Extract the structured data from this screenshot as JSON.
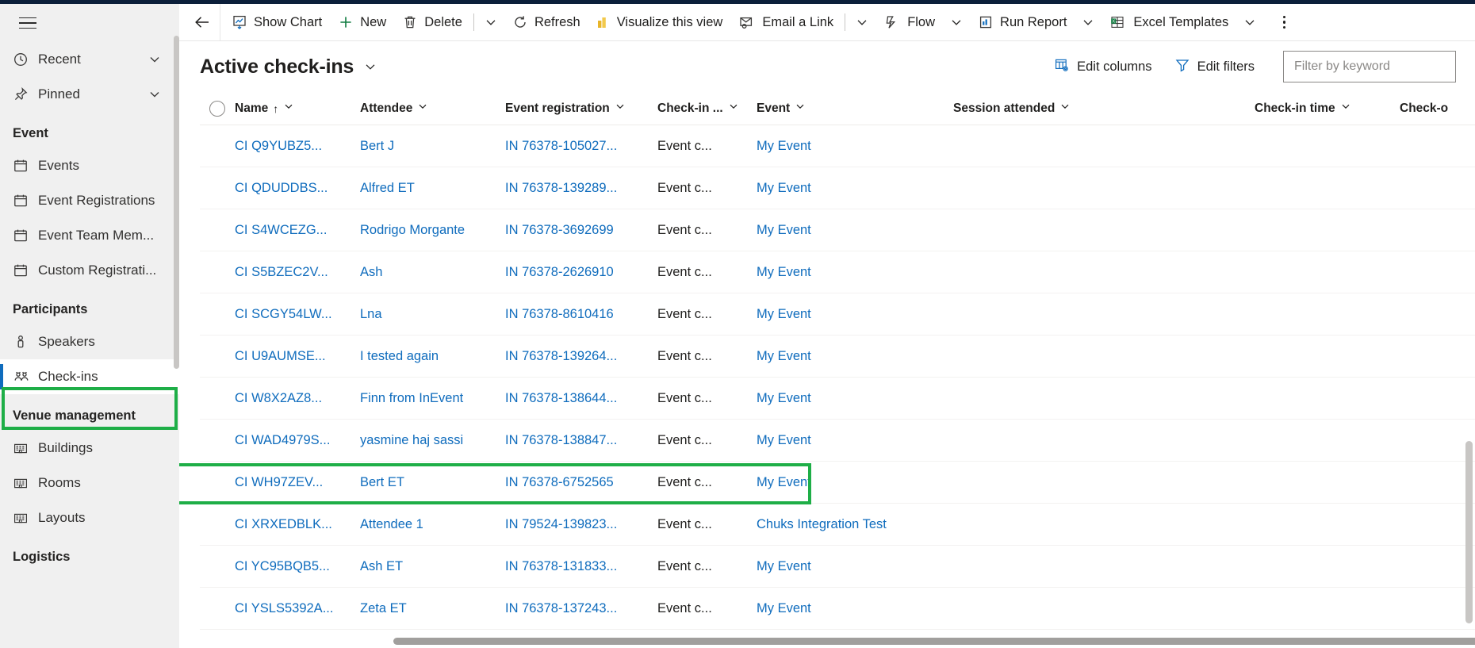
{
  "sidebar": {
    "menu_icon": "hamburger-icon",
    "top_items": [
      {
        "label": "Recent",
        "icon": "clock-icon",
        "chevron": "chevron-down-icon"
      },
      {
        "label": "Pinned",
        "icon": "pin-icon",
        "chevron": "chevron-down-icon"
      }
    ],
    "groups": [
      {
        "heading": "Event",
        "items": [
          {
            "label": "Events",
            "icon": "calendar-icon"
          },
          {
            "label": "Event Registrations",
            "icon": "calendar-icon"
          },
          {
            "label": "Event Team Mem...",
            "icon": "calendar-icon"
          },
          {
            "label": "Custom Registrati...",
            "icon": "calendar-icon"
          }
        ]
      },
      {
        "heading": "Participants",
        "items": [
          {
            "label": "Speakers",
            "icon": "speaker-person-icon"
          },
          {
            "label": "Check-ins",
            "icon": "check-in-people-icon",
            "selected": true
          }
        ]
      },
      {
        "heading": "Venue management",
        "items": [
          {
            "label": "Buildings",
            "icon": "building-icon"
          },
          {
            "label": "Rooms",
            "icon": "building-icon"
          },
          {
            "label": "Layouts",
            "icon": "building-icon"
          }
        ]
      },
      {
        "heading": "Logistics",
        "items": []
      }
    ]
  },
  "commandbar": {
    "back_icon": "back-arrow-icon",
    "buttons": [
      {
        "label": "Show Chart",
        "icon": "chart-icon"
      },
      {
        "label": "New",
        "icon": "plus-icon"
      },
      {
        "label": "Delete",
        "icon": "trash-icon",
        "chevron": "chevron-down-icon",
        "separator_before_chevron": true
      },
      {
        "label": "Refresh",
        "icon": "refresh-icon"
      },
      {
        "label": "Visualize this view",
        "icon": "powerbi-icon"
      },
      {
        "label": "Email a Link",
        "icon": "email-icon",
        "chevron": "chevron-down-icon",
        "separator_before_chevron": true
      },
      {
        "label": "Flow",
        "icon": "flow-icon",
        "chevron": "chevron-down-icon"
      },
      {
        "label": "Run Report",
        "icon": "report-icon",
        "chevron": "chevron-down-icon"
      },
      {
        "label": "Excel Templates",
        "icon": "excel-icon",
        "chevron": "chevron-down-icon"
      }
    ],
    "overflow_icon": "more-vertical-icon"
  },
  "view": {
    "title": "Active check-ins",
    "title_chevron": "chevron-down-icon",
    "edit_columns": {
      "label": "Edit columns",
      "icon": "edit-columns-icon"
    },
    "edit_filters": {
      "label": "Edit filters",
      "icon": "filter-icon"
    },
    "filter_input": {
      "placeholder": "Filter by keyword",
      "value": ""
    }
  },
  "grid": {
    "select_all_icon": "radio-circle-icon",
    "columns": [
      {
        "label": "Name",
        "sorted": "ascending",
        "sort_icon": "arrow-up-icon",
        "chevron": "chevron-down-icon"
      },
      {
        "label": "Attendee",
        "chevron": "chevron-down-icon"
      },
      {
        "label": "Event registration",
        "chevron": "chevron-down-icon"
      },
      {
        "label": "Check-in ...",
        "chevron": "chevron-down-icon"
      },
      {
        "label": "Event",
        "chevron": "chevron-down-icon"
      },
      {
        "label": "Session attended",
        "chevron": "chevron-down-icon"
      },
      {
        "label": "Check-in time",
        "chevron": "chevron-down-icon"
      },
      {
        "label": "Check-o",
        "chevron": ""
      }
    ],
    "rows": [
      {
        "name": "CI Q9YUBZ5...",
        "attendee": "Bert J",
        "registration": "IN 76378-105027...",
        "checkin_type": "Event c...",
        "event": "My Event",
        "session": "",
        "checkin_time": "",
        "checkout": ""
      },
      {
        "name": "CI QDUDDBS...",
        "attendee": "Alfred ET",
        "registration": "IN 76378-139289...",
        "checkin_type": "Event c...",
        "event": "My Event",
        "session": "",
        "checkin_time": "",
        "checkout": ""
      },
      {
        "name": "CI S4WCEZG...",
        "attendee": "Rodrigo Morgante",
        "registration": "IN 76378-3692699",
        "checkin_type": "Event c...",
        "event": "My Event",
        "session": "",
        "checkin_time": "",
        "checkout": ""
      },
      {
        "name": "CI S5BZEC2V...",
        "attendee": "Ash",
        "registration": "IN 76378-2626910",
        "checkin_type": "Event c...",
        "event": "My Event",
        "session": "",
        "checkin_time": "",
        "checkout": ""
      },
      {
        "name": "CI SCGY54LW...",
        "attendee": "Lna",
        "registration": "IN 76378-8610416",
        "checkin_type": "Event c...",
        "event": "My Event",
        "session": "",
        "checkin_time": "",
        "checkout": ""
      },
      {
        "name": "CI U9AUMSE...",
        "attendee": "I tested again",
        "registration": "IN 76378-139264...",
        "checkin_type": "Event c...",
        "event": "My Event",
        "session": "",
        "checkin_time": "",
        "checkout": ""
      },
      {
        "name": "CI W8X2AZ8...",
        "attendee": "Finn from InEvent",
        "registration": "IN 76378-138644...",
        "checkin_type": "Event c...",
        "event": "My Event",
        "session": "",
        "checkin_time": "",
        "checkout": ""
      },
      {
        "name": "CI WAD4979S...",
        "attendee": "yasmine haj sassi",
        "registration": "IN 76378-138847...",
        "checkin_type": "Event c...",
        "event": "My Event",
        "session": "",
        "checkin_time": "",
        "checkout": ""
      },
      {
        "name": "CI WH97ZEV...",
        "attendee": "Bert ET",
        "registration": "IN 76378-6752565",
        "checkin_type": "Event c...",
        "event": "My Event",
        "session": "",
        "checkin_time": "",
        "checkout": ""
      },
      {
        "name": "CI XRXEDBLK...",
        "attendee": "Attendee 1",
        "registration": "IN 79524-139823...",
        "checkin_type": "Event c...",
        "event": "Chuks Integration Test",
        "session": "",
        "checkin_time": "",
        "checkout": ""
      },
      {
        "name": "CI YC95BQB5...",
        "attendee": "Ash ET",
        "registration": "IN 76378-131833...",
        "checkin_type": "Event c...",
        "event": "My Event",
        "session": "",
        "checkin_time": "",
        "checkout": "",
        "highlighted": true
      },
      {
        "name": "CI YSLS5392A...",
        "attendee": "Zeta ET",
        "registration": "IN 76378-137243...",
        "checkin_type": "Event c...",
        "event": "My Event",
        "session": "",
        "checkin_time": "",
        "checkout": ""
      }
    ]
  },
  "colors": {
    "highlight": "#1eae47",
    "link": "#0f6cbd",
    "accent_bar": "#0f6cbd",
    "sidebar_bg": "#f0f0f0",
    "top_strip": "#0b1f3a"
  }
}
